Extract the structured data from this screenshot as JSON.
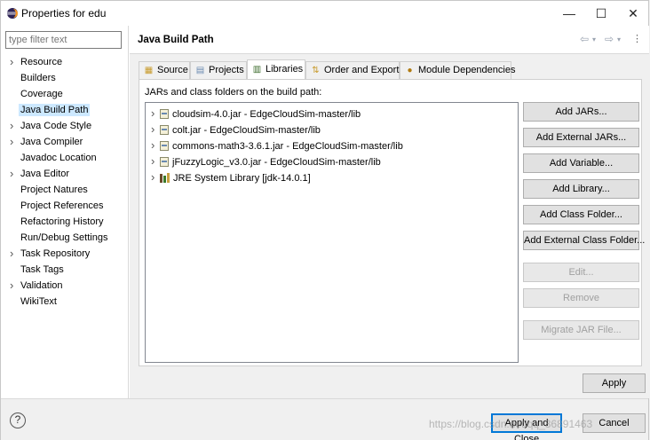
{
  "window": {
    "title": "Properties for edu",
    "controls": {
      "minimize": "—",
      "maximize": "☐",
      "close": "✕"
    }
  },
  "sidebar": {
    "filter_placeholder": "type filter text",
    "items": [
      {
        "label": "Resource",
        "expandable": true
      },
      {
        "label": "Builders",
        "expandable": false
      },
      {
        "label": "Coverage",
        "expandable": false
      },
      {
        "label": "Java Build Path",
        "expandable": false,
        "selected": true
      },
      {
        "label": "Java Code Style",
        "expandable": true
      },
      {
        "label": "Java Compiler",
        "expandable": true
      },
      {
        "label": "Javadoc Location",
        "expandable": false
      },
      {
        "label": "Java Editor",
        "expandable": true
      },
      {
        "label": "Project Natures",
        "expandable": false
      },
      {
        "label": "Project References",
        "expandable": false
      },
      {
        "label": "Refactoring History",
        "expandable": false
      },
      {
        "label": "Run/Debug Settings",
        "expandable": false
      },
      {
        "label": "Task Repository",
        "expandable": true
      },
      {
        "label": "Task Tags",
        "expandable": false
      },
      {
        "label": "Validation",
        "expandable": true
      },
      {
        "label": "WikiText",
        "expandable": false
      }
    ]
  },
  "page": {
    "title": "Java Build Path",
    "nav_icons": [
      "back-arrow-icon",
      "dropdown-icon",
      "forward-arrow-icon",
      "dropdown-icon",
      "view-menu-icon"
    ]
  },
  "tabs": [
    {
      "label": "Source",
      "icon": "source-folder-icon"
    },
    {
      "label": "Projects",
      "icon": "projects-icon"
    },
    {
      "label": "Libraries",
      "icon": "libraries-icon",
      "active": true
    },
    {
      "label": "Order and Export",
      "icon": "order-export-icon"
    },
    {
      "label": "Module Dependencies",
      "icon": "module-icon"
    }
  ],
  "libraries": {
    "caption": "JARs and class folders on the build path:",
    "entries": [
      {
        "label": "cloudsim-4.0.jar - EdgeCloudSim-master/lib",
        "icon": "jar-icon"
      },
      {
        "label": "colt.jar - EdgeCloudSim-master/lib",
        "icon": "jar-icon"
      },
      {
        "label": "commons-math3-3.6.1.jar - EdgeCloudSim-master/lib",
        "icon": "jar-icon"
      },
      {
        "label": "jFuzzyLogic_v3.0.jar - EdgeCloudSim-master/lib",
        "icon": "jar-icon"
      },
      {
        "label": "JRE System Library [jdk-14.0.1]",
        "icon": "jre-library-icon"
      }
    ],
    "buttons": [
      {
        "label": "Add JARs...",
        "enabled": true
      },
      {
        "label": "Add External JARs...",
        "enabled": true
      },
      {
        "label": "Add Variable...",
        "enabled": true
      },
      {
        "label": "Add Library...",
        "enabled": true
      },
      {
        "label": "Add Class Folder...",
        "enabled": true
      },
      {
        "label": "Add External Class Folder...",
        "enabled": true
      },
      {
        "label": "Edit...",
        "enabled": false
      },
      {
        "label": "Remove",
        "enabled": false
      },
      {
        "label": "Migrate JAR File...",
        "enabled": false
      }
    ]
  },
  "apply_label": "Apply",
  "footer": {
    "help": "?",
    "apply_close": "Apply and Close",
    "cancel": "Cancel",
    "watermark": "https://blog.csdn.net/qq_36891463"
  },
  "colors": {
    "selection": "#cce8ff",
    "default_border": "#0078d7"
  }
}
